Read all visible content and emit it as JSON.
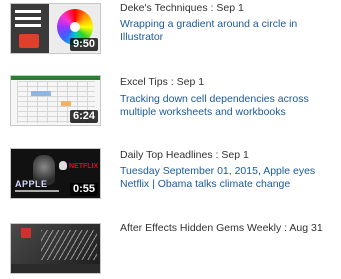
{
  "videos": [
    {
      "meta": "Deke's Techniques : Sep 1",
      "title": "Wrapping a gradient around a circle in Illustrator",
      "duration": "9:50",
      "thumbnail_icon": "illustrator-color-wheel-thumbnail"
    },
    {
      "meta": "Excel Tips : Sep 1",
      "title": "Tracking down cell dependencies across multiple worksheets and workbooks",
      "duration": "6:24",
      "thumbnail_icon": "excel-spreadsheet-thumbnail"
    },
    {
      "meta": "Daily Top Headlines : Sep 1",
      "title": "Tuesday September 01, 2015, Apple eyes Netflix | Obama talks climate change",
      "duration": "0:55",
      "thumbnail_icon": "news-apple-netflix-thumbnail",
      "thumbnail_text": {
        "left": "APPLE",
        "right": "NETFLIX"
      }
    },
    {
      "meta": "After Effects Hidden Gems Weekly : Aug 31",
      "title": "",
      "duration": "",
      "thumbnail_icon": "after-effects-thumbnail"
    }
  ],
  "colors": {
    "link": "#1a5a9a",
    "meta_text": "#333333",
    "duration_badge_bg": "#000000"
  }
}
